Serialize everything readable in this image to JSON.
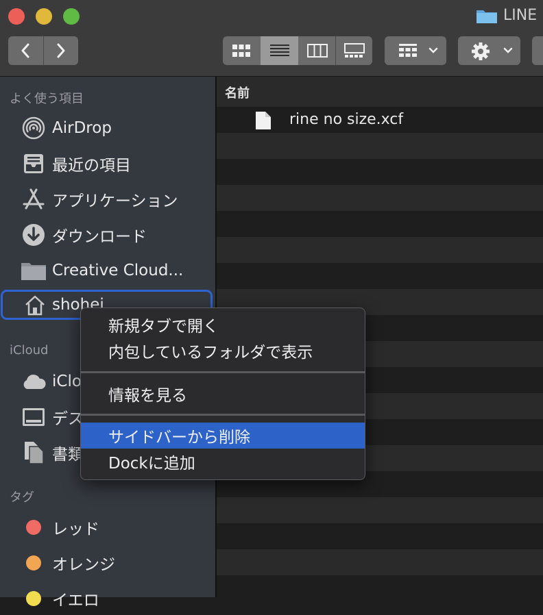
{
  "window": {
    "title": "LINE",
    "traffic_lights": {
      "close": "#ec5f58",
      "minimize": "#e0b93a",
      "zoom": "#5fbb44"
    }
  },
  "toolbar": {
    "back_icon": "chevron-left-icon",
    "forward_icon": "chevron-right-icon",
    "view_modes": [
      "icon-view",
      "list-view",
      "column-view",
      "gallery-view"
    ],
    "selected_view": "list-view",
    "group_icon": "group-grid-icon",
    "action_icon": "gear-icon"
  },
  "sidebar": {
    "favorites_header": "よく使う項目",
    "favorites": [
      {
        "label": "AirDrop",
        "icon": "airdrop-icon"
      },
      {
        "label": "最近の項目",
        "icon": "recents-icon"
      },
      {
        "label": "アプリケーション",
        "icon": "applications-icon"
      },
      {
        "label": "ダウンロード",
        "icon": "downloads-icon"
      },
      {
        "label": "Creative Cloud...",
        "icon": "folder-icon"
      },
      {
        "label": "shohei",
        "icon": "home-icon"
      }
    ],
    "icloud_header": "iCloud",
    "icloud": [
      {
        "label": "iClo",
        "icon": "cloud-icon"
      },
      {
        "label": "デス",
        "icon": "desktop-icon"
      },
      {
        "label": "書類",
        "icon": "documents-icon"
      }
    ],
    "tags_header": "タグ",
    "tags": [
      {
        "label": "レッド",
        "color": "#ef6b63"
      },
      {
        "label": "オレンジ",
        "color": "#f2a552"
      },
      {
        "label": "イエロ",
        "color": "#f2dc4f"
      }
    ]
  },
  "file_list": {
    "column_name": "名前",
    "files": [
      {
        "name": "rine no size.xcf",
        "icon": "document-icon"
      }
    ]
  },
  "context_menu": {
    "items": [
      {
        "label": "新規タブで開く"
      },
      {
        "label": "内包しているフォルダで表示"
      },
      {
        "label": "情報を見る"
      },
      {
        "label": "サイドバーから削除",
        "highlighted": true
      },
      {
        "label": "Dockに追加"
      }
    ],
    "highlight_color": "#2d63c8"
  }
}
